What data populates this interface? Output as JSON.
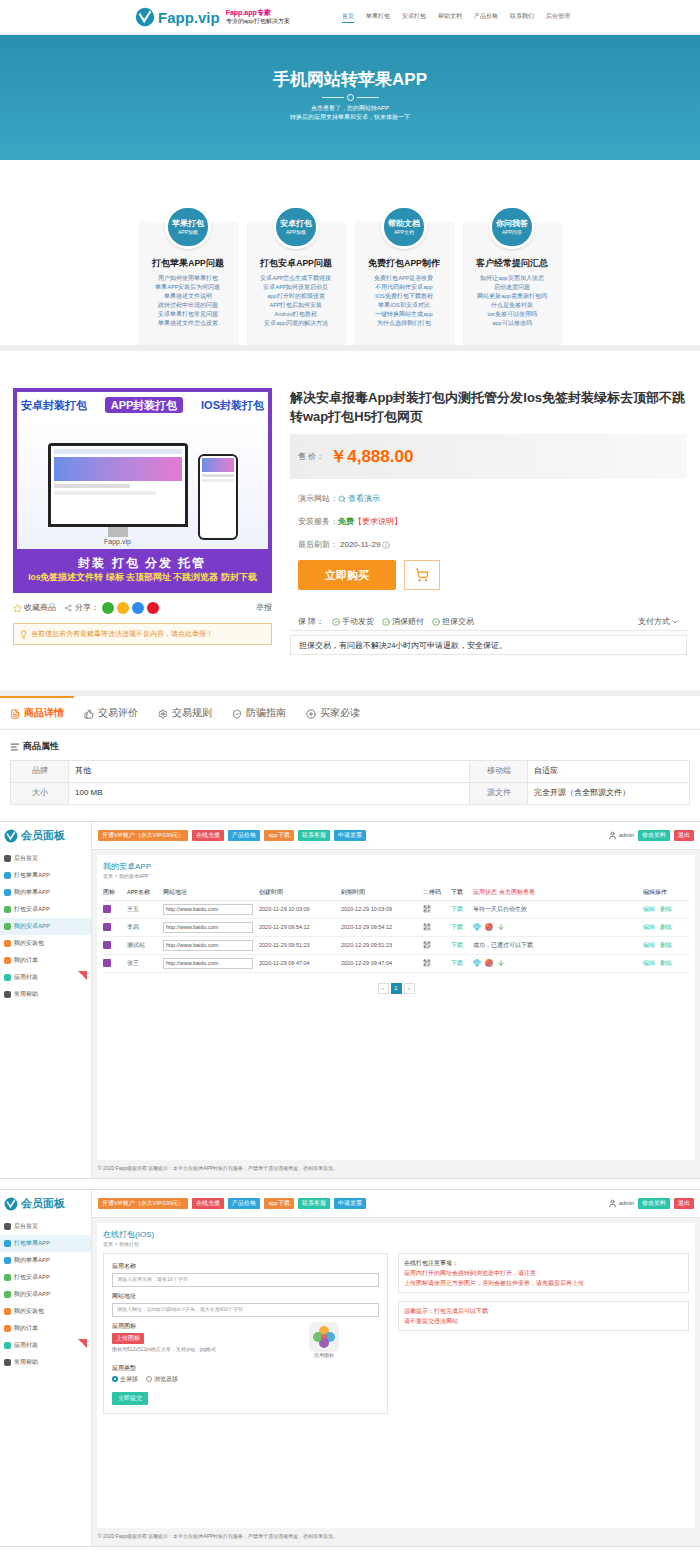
{
  "header": {
    "logo": "Fapp.vip",
    "logo_tag": "Fapp.app专家",
    "logo_sub": "专业的app打包解决方案",
    "nav": [
      {
        "label": "首页",
        "selected": true
      },
      {
        "label": "苹果打包",
        "selected": false
      },
      {
        "label": "安卓打包",
        "selected": false
      },
      {
        "label": "帮助文档",
        "selected": false
      },
      {
        "label": "产品价格",
        "selected": false
      },
      {
        "label": "联系我们",
        "selected": false
      },
      {
        "label": "后台管理",
        "selected": false
      }
    ]
  },
  "banner": {
    "title": "手机网站转苹果APP",
    "lines": [
      "点击查看了，您的网站转APP",
      "转换后的应用支持苹果和安卓，快来体验一下"
    ]
  },
  "help_cards": [
    {
      "badge": "苹果打包",
      "badge_sub": "APP加载",
      "title": "打包苹果APP问题",
      "items": [
        "用户如何使用苹果打包",
        "苹果APP安装后为何闪退",
        "苹果描述文件说明",
        "跳转过程中出现的问题",
        "安卓苹果打包常见问题",
        "苹果描述文件怎么设置"
      ]
    },
    {
      "badge": "安卓打包",
      "badge_sub": "APP加载",
      "title": "打包安卓APP问题",
      "items": [
        "安卓APP怎么生成下载链接",
        "安卓APP如何设置启动页",
        "app打开时的权限设置",
        "APP打包后如何安装",
        "Android打包教程",
        "安卓app闪退的解决方法"
      ]
    },
    {
      "badge": "帮助文档",
      "badge_sub": "APP文档",
      "title": "免费打包APP制作",
      "items": [
        "免费打包APP是否收费",
        "不用代码制作安卓app",
        "IOS免费打包下载教程",
        "苹果IOS和安卓对比",
        "一键转换网站生成app",
        "为什么选择我们打包"
      ]
    },
    {
      "badge": "你问我答",
      "badge_sub": "APP问答",
      "title": "客户经常提问汇总",
      "items": [
        "如何让app页面加入状态",
        "启动速度问题",
        "网站更新app需重新打包吗",
        "什么是免签封装",
        "ios免签可以使用吗",
        "app可以修改吗"
      ]
    }
  ],
  "product": {
    "image": {
      "tags": [
        {
          "label": "安卓封装打包",
          "kind": "plain"
        },
        {
          "label": "APP封装打包",
          "kind": "ribbon"
        },
        {
          "label": "IOS封装打包",
          "kind": "plain"
        }
      ],
      "caption": "Fapp.vip",
      "slogan": "封装 打包 分发 托管",
      "features": "Ios免签描述文件转 绿标 去顶部网址 不跳浏览器 防封下载"
    },
    "title": "解决安卓报毒App封装打包内测托管分发Ios免签封装绿标去顶部不跳转wap打包H5打包网页",
    "price_label": "售 价：",
    "price": "￥4,888.00",
    "demo": {
      "label": "演示网站：",
      "value": "查看演示"
    },
    "install": {
      "label": "安装服务：",
      "value": "免费",
      "extra": "【要求说明】"
    },
    "refresh": {
      "label": "最后刷新：",
      "value": "2020-11-29"
    },
    "buy": "立即购买",
    "favorite": "收藏商品",
    "share": "分享：",
    "share_icons": [
      {
        "color": "#3cb034"
      },
      {
        "color": "#f5b21b"
      },
      {
        "color": "#2d8cf0"
      },
      {
        "color": "#e6162d"
      }
    ],
    "report": "举报",
    "warning": "当前信息若含有黄赌毒等违法违规不良内容，请点此举报！",
    "guarantee_label": "保 障：",
    "guarantees": [
      "手动发货",
      "消保赔付",
      "担保交易"
    ],
    "payment": "支付方式",
    "note": "担保交易，有问题不解决24小时内可申请退款，安全保证。"
  },
  "detail_tabs": [
    {
      "label": "商品详情",
      "selected": true
    },
    {
      "label": "交易评价",
      "selected": false
    },
    {
      "label": "交易规则",
      "selected": false
    },
    {
      "label": "防骗指南",
      "selected": false
    },
    {
      "label": "买家必读",
      "selected": false
    }
  ],
  "attributes": {
    "title": "商品属性",
    "rows": [
      [
        "品牌",
        "其他",
        "移动端",
        "自适应"
      ],
      [
        "大小",
        "100 MB",
        "源文件",
        "完全开源（含全部源文件）"
      ]
    ]
  },
  "panels": [
    {
      "kind": "table",
      "brand": "会员面板",
      "top_buttons": [
        {
          "label": "开通VIP账户（永久VIP/199元）",
          "color": "#f0883a"
        },
        {
          "label": "在线充值",
          "color": "#e9545b"
        },
        {
          "label": "产品价格",
          "color": "#2fa4d9"
        },
        {
          "label": "app下载",
          "color": "#f0883a"
        },
        {
          "label": "联系客服",
          "color": "#2cc3a6"
        },
        {
          "label": "申请发票",
          "color": "#2fa4d9"
        }
      ],
      "user": "admin",
      "user_buttons": [
        {
          "label": "修改资料",
          "color": "#2cc3a6"
        },
        {
          "label": "退出",
          "color": "#e9545b"
        }
      ],
      "sidebar": [
        {
          "label": "后台首页",
          "selected": false,
          "color": "#555555",
          "badge": false
        },
        {
          "label": "打包苹果APP",
          "selected": false,
          "color": "#2fa4d9",
          "badge": false
        },
        {
          "label": "我的苹果APP",
          "selected": false,
          "color": "#2fa4d9",
          "badge": false
        },
        {
          "label": "打包安卓APP",
          "selected": false,
          "color": "#5cb85c",
          "badge": false
        },
        {
          "label": "我的安卓APP",
          "selected": true,
          "color": "#5cb85c",
          "badge": false
        },
        {
          "label": "我的安装包",
          "selected": false,
          "color": "#f0883a",
          "badge": false
        },
        {
          "label": "我的订单",
          "selected": false,
          "color": "#f0883a",
          "badge": false
        },
        {
          "label": "应用封装",
          "selected": false,
          "color": "#2cc3a6",
          "badge": true
        },
        {
          "label": "常用帮助",
          "selected": false,
          "color": "#555555",
          "badge": false
        }
      ],
      "title": "我的安卓APP",
      "breadcrumb": "首页 > 我的安卓APP",
      "columns": [
        "图标",
        "APP名称",
        "网站地址",
        "创建时间",
        "到期时间",
        "二维码",
        "下载",
        "应用状态 点击图标查看",
        "编辑操作"
      ],
      "rows": [
        {
          "name": "王五",
          "url": "http://www.baidu.com",
          "created": "2020-11-29 10:03:09",
          "expires": "2020-12-29 10:03:09",
          "download": "下载",
          "status_kind": "text",
          "status": "等待一天后自动生效",
          "actions": "编辑 · 删除"
        },
        {
          "name": "李四",
          "url": "http://www.baidu.com",
          "created": "2020-11-29 09:54:12",
          "expires": "2020-12-29 09:54:12",
          "download": "下载",
          "status_kind": "icons",
          "status": "",
          "actions": "编辑 · 删除"
        },
        {
          "name": "测试站",
          "url": "http://www.baidu.com",
          "created": "2020-11-29 09:51:23",
          "expires": "2020-12-29 09:51:23",
          "download": "下载",
          "status_kind": "text",
          "status": "成功，已通过可以下载",
          "actions": "编辑 · 删除"
        },
        {
          "name": "张三",
          "url": "http://www.baidu.com",
          "created": "2020-11-29 09:47:04",
          "expires": "2020-12-29 09:47:04",
          "download": "下载",
          "status_kind": "icons",
          "status": "",
          "actions": "编辑 · 删除"
        }
      ],
      "pagination": [
        {
          "label": "‹",
          "selected": false
        },
        {
          "label": "1",
          "selected": true
        },
        {
          "label": "›",
          "selected": false
        }
      ],
      "footer": "© 2020 Fapp版权所有 温馨提示：本平台仅提供APP封装打包服务，严禁用于违法违规用途，否则后果自负。"
    },
    {
      "kind": "form",
      "brand": "会员面板",
      "top_buttons": [
        {
          "label": "开通VIP账户（永久VIP/199元）",
          "color": "#f0883a"
        },
        {
          "label": "在线充值",
          "color": "#e9545b"
        },
        {
          "label": "产品价格",
          "color": "#2fa4d9"
        },
        {
          "label": "app下载",
          "color": "#f0883a"
        },
        {
          "label": "联系客服",
          "color": "#2cc3a6"
        },
        {
          "label": "申请发票",
          "color": "#2fa4d9"
        }
      ],
      "user": "admin",
      "user_buttons": [
        {
          "label": "修改资料",
          "color": "#2cc3a6"
        },
        {
          "label": "退出",
          "color": "#e9545b"
        }
      ],
      "sidebar": [
        {
          "label": "后台首页",
          "selected": false,
          "color": "#555555",
          "badge": false
        },
        {
          "label": "打包苹果APP",
          "selected": true,
          "color": "#2fa4d9",
          "badge": false
        },
        {
          "label": "我的苹果APP",
          "selected": false,
          "color": "#2fa4d9",
          "badge": false
        },
        {
          "label": "打包安卓APP",
          "selected": false,
          "color": "#5cb85c",
          "badge": false
        },
        {
          "label": "我的安卓APP",
          "selected": false,
          "color": "#5cb85c",
          "badge": false
        },
        {
          "label": "我的安装包",
          "selected": false,
          "color": "#f0883a",
          "badge": false
        },
        {
          "label": "我的订单",
          "selected": false,
          "color": "#f0883a",
          "badge": false
        },
        {
          "label": "应用封装",
          "selected": false,
          "color": "#2cc3a6",
          "badge": true
        },
        {
          "label": "常用帮助",
          "selected": false,
          "color": "#555555",
          "badge": false
        }
      ],
      "title": "在线打包(IOS)",
      "breadcrumb": "首页 > 在线打包",
      "fields": [
        {
          "label": "应用名称",
          "placeholder": "请输入应用名称，最多16个字符"
        },
        {
          "label": "网站地址",
          "placeholder": "请输入网址，以http://或https://开头，最大长度400个字符"
        }
      ],
      "icon_label": "应用图标",
      "upload": "上传图标",
      "upload_hint": "图标为512x512px的正方形，支持png、jpg格式",
      "icon_caption": "应用图标",
      "type_label": "应用类型",
      "types": [
        {
          "label": "全屏版",
          "selected": true
        },
        {
          "label": "浏览器版",
          "selected": false
        }
      ],
      "submit": "立即提交",
      "notes": [
        [
          "在线打包注意事项：",
          "应用内打开的网址会跳转到浏览器中打开，请注意",
          "上传图标请使用正方形图片，否则会被拉伸变形，请先裁剪后再上传"
        ],
        [
          "温馨提示：打包完成后可以下载",
          "请不要提交违法网站"
        ]
      ],
      "footer": "© 2020 Fapp版权所有 温馨提示：本平台仅提供APP封装打包服务，严禁用于违法违规用途，否则后果自负。"
    }
  ]
}
